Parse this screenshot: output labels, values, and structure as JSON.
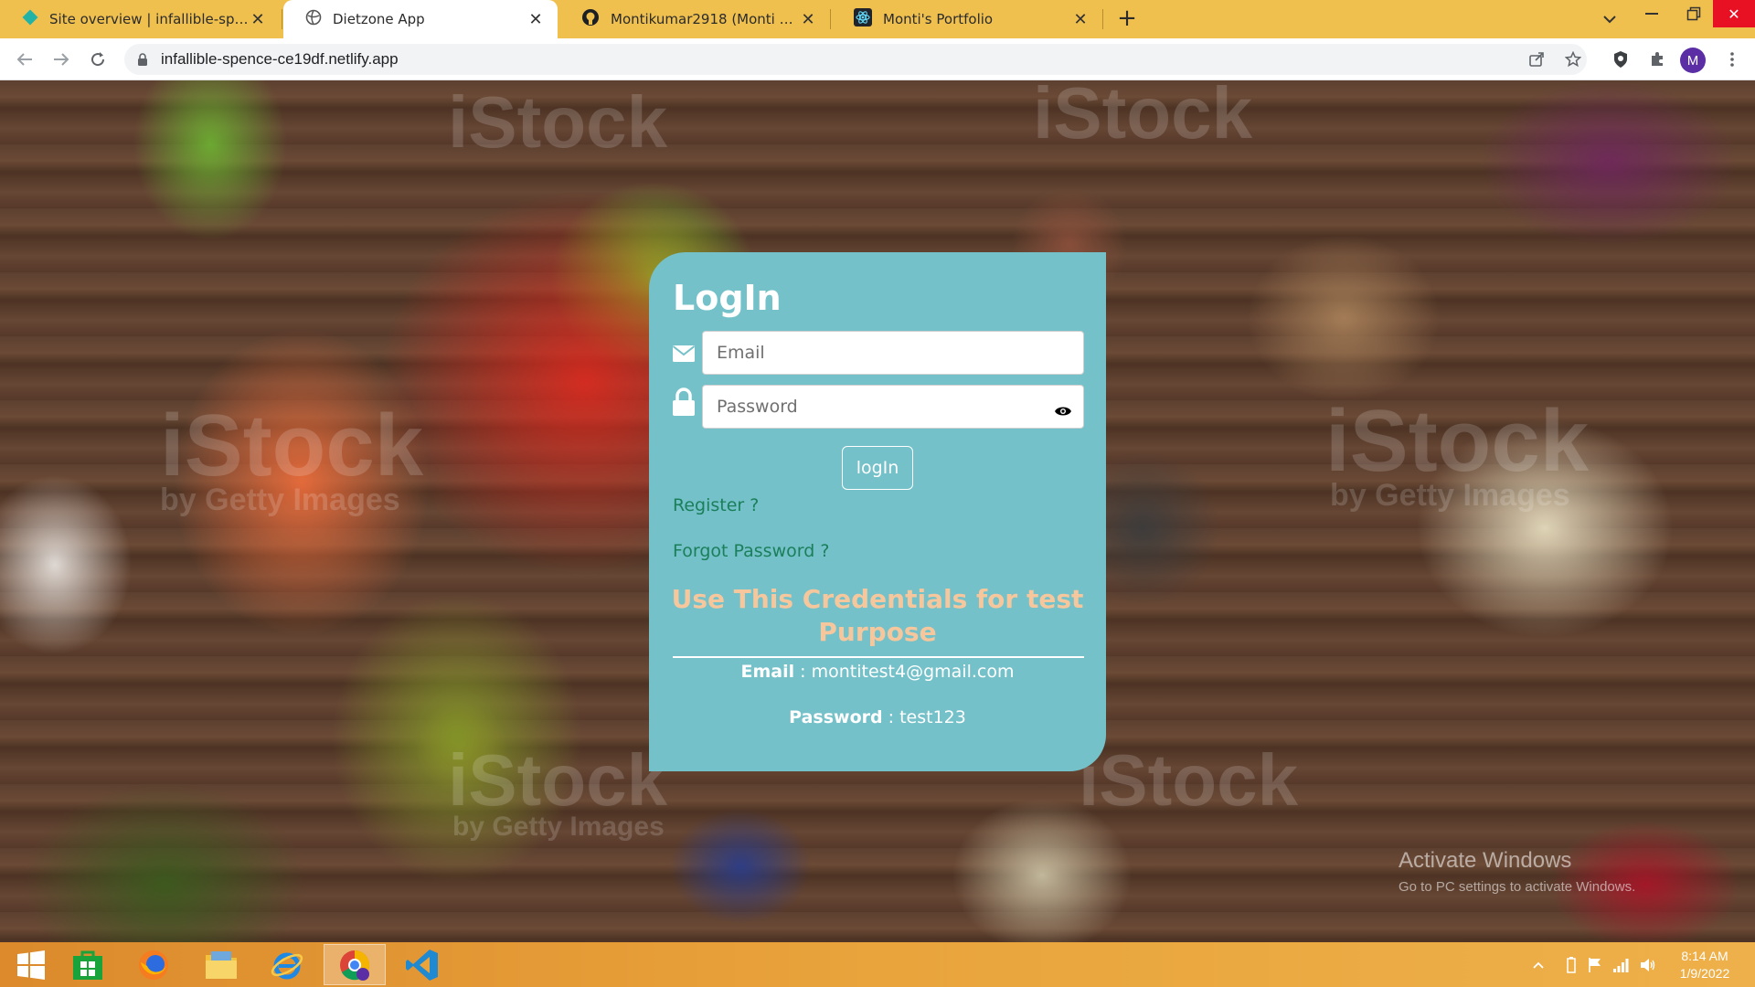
{
  "browser": {
    "tabs": [
      {
        "title": "Site overview | infallible-spence-c",
        "icon": "netlify-diamond-icon"
      },
      {
        "title": "Dietzone App",
        "icon": "globe-icon"
      },
      {
        "title": "Montikumar2918 (Monti kumar)",
        "icon": "github-icon"
      },
      {
        "title": "Monti's Portfolio",
        "icon": "react-icon"
      }
    ],
    "url": "infallible-spence-ce19df.netlify.app",
    "avatar_letter": "M"
  },
  "login": {
    "title": "LogIn",
    "email_placeholder": "Email",
    "password_placeholder": "Password",
    "button_label": "logIn",
    "register_link": "Register ?",
    "forgot_link": "Forgot Password ?",
    "cred_title": "Use This Credentials for test Purpose",
    "email_label": "Email",
    "email_value": ": montitest4@gmail.com",
    "password_label": "Password",
    "password_value": ": test123"
  },
  "watermark": {
    "brand": "iStock",
    "byline": "by Getty Images"
  },
  "activation": {
    "title": "Activate Windows",
    "subtitle": "Go to PC settings to activate Windows."
  },
  "taskbar": {
    "apps": [
      "windows-start-icon",
      "store-icon",
      "firefox-icon",
      "file-explorer-icon",
      "internet-explorer-icon",
      "chrome-icon",
      "vscode-icon"
    ],
    "time": "8:14 AM",
    "date": "1/9/2022"
  },
  "colors": {
    "card": "#75c1c9",
    "cred_title": "#f6c79c",
    "link": "#1a7f5a",
    "tabstrip": "#f0c04f"
  }
}
